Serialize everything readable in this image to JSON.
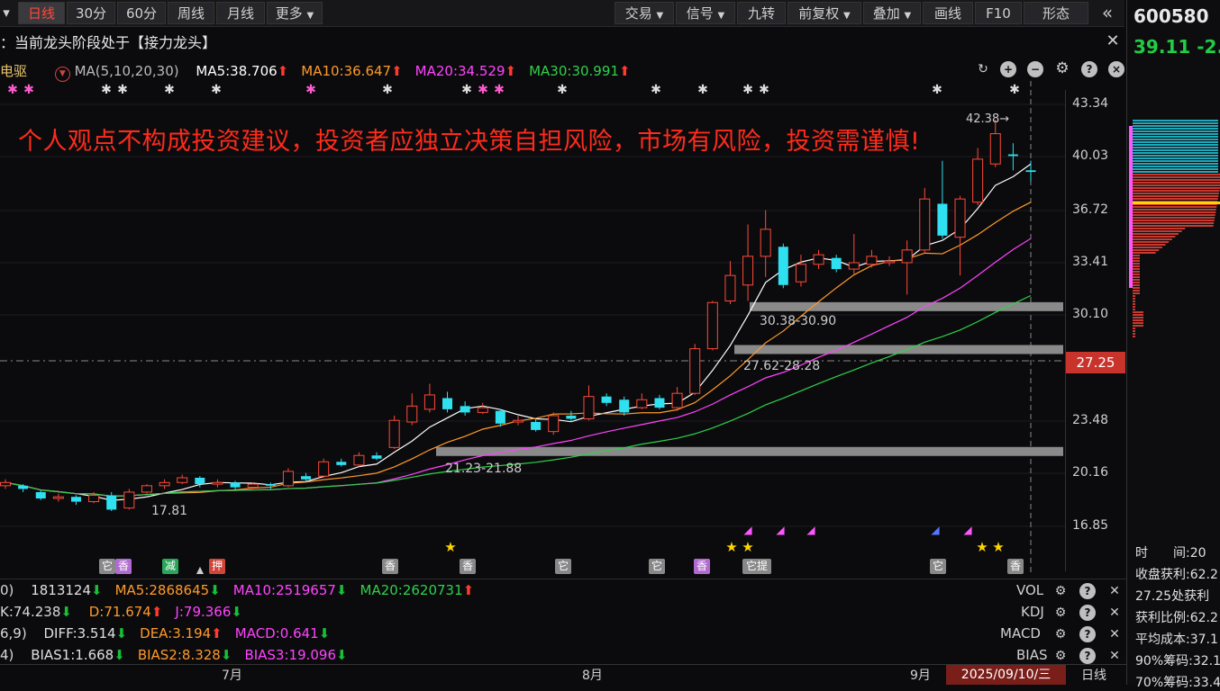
{
  "toolbar": {
    "tabs": [
      {
        "label": "日线",
        "active": true
      },
      {
        "label": "30分",
        "active": false
      },
      {
        "label": "60分",
        "active": false
      },
      {
        "label": "周线",
        "active": false
      },
      {
        "label": "月线",
        "active": false
      },
      {
        "label": "更多",
        "active": false
      }
    ],
    "right_buttons": [
      "交易",
      "信号",
      "九转",
      "前复权",
      "叠加",
      "画线",
      "F10",
      "形态"
    ]
  },
  "subtitle": "：当前龙头阶段处于【接力龙头】",
  "main_indicator": {
    "name": "电驱",
    "params": "MA(5,10,20,30)",
    "items": [
      {
        "label": "MA5:38.706",
        "color": "#ffffff",
        "dir": "up"
      },
      {
        "label": "MA10:36.647",
        "color": "#ff9a2a",
        "dir": "up"
      },
      {
        "label": "MA20:34.529",
        "color": "#ff44ff",
        "dir": "up"
      },
      {
        "label": "MA30:30.991",
        "color": "#2fd14a",
        "dir": "up"
      }
    ]
  },
  "warning": "个人观点不构成投资建议，投资者应独立决策自担风险，市场有风险，投资需谨慎!",
  "price_ticks": [
    "43.34",
    "40.03",
    "36.72",
    "33.41",
    "30.10",
    "23.48",
    "20.16",
    "16.85"
  ],
  "current_price_label": "27.25",
  "zones": [
    {
      "label": "30.38-30.90"
    },
    {
      "label": "27.62-28.28"
    },
    {
      "label": "21.23-21.88"
    }
  ],
  "annotations": {
    "low": "17.81",
    "high": "42.38→"
  },
  "tags": [
    {
      "label": "它",
      "color": "#888"
    },
    {
      "label": "香",
      "color": "#b06ad0"
    },
    {
      "label": "减",
      "color": "#2aa55a"
    },
    {
      "label": "押",
      "color": "#d0453a"
    },
    {
      "label": "香",
      "color": "#888"
    },
    {
      "label": "香",
      "color": "#888"
    },
    {
      "label": "它",
      "color": "#888"
    },
    {
      "label": "它",
      "color": "#888"
    },
    {
      "label": "香",
      "color": "#b06ad0"
    },
    {
      "label": "它提",
      "color": "#888"
    },
    {
      "label": "它",
      "color": "#888"
    },
    {
      "label": "香",
      "color": "#888"
    }
  ],
  "indicators": {
    "vol": {
      "lead": "0)",
      "items": [
        {
          "label": "1813124",
          "color": "#e0e0e0",
          "dir": "dn"
        },
        {
          "label": "MA5:2868645",
          "color": "#ff9a2a",
          "dir": "dn"
        },
        {
          "label": "MA10:2519657",
          "color": "#ff44ff",
          "dir": "dn"
        },
        {
          "label": "MA20:2620731",
          "color": "#2fd14a",
          "dir": "up"
        }
      ],
      "name": "VOL"
    },
    "kdj": {
      "lead": "K:74.238",
      "items": [
        {
          "label": "D:71.674",
          "color": "#ff9a2a",
          "dir": "up"
        },
        {
          "label": "J:79.366",
          "color": "#ff44ff",
          "dir": "dn"
        }
      ],
      "name": "KDJ"
    },
    "macd": {
      "lead": "6,9)",
      "items": [
        {
          "label": "DIFF:3.514",
          "color": "#e0e0e0",
          "dir": "dn"
        },
        {
          "label": "DEA:3.194",
          "color": "#ff9a2a",
          "dir": "up"
        },
        {
          "label": "MACD:0.641",
          "color": "#ff44ff",
          "dir": "dn"
        }
      ],
      "name": "MACD"
    },
    "bias": {
      "lead": "4)",
      "items": [
        {
          "label": "BIAS1:1.668",
          "color": "#e0e0e0",
          "dir": "dn"
        },
        {
          "label": "BIAS2:8.328",
          "color": "#ff9a2a",
          "dir": "dn"
        },
        {
          "label": "BIAS3:19.096",
          "color": "#ff44ff",
          "dir": "dn"
        }
      ],
      "name": "BIAS"
    }
  },
  "x_axis": {
    "months": [
      "7月",
      "8月",
      "9月"
    ],
    "date": "2025/09/10/三",
    "period": "日线"
  },
  "right_panel": {
    "code": "600580",
    "price": "39.11",
    "change": "-2.",
    "lines": [
      "时　　间:20",
      "收盘获利:62.2",
      "27.25处获利",
      "获利比例:62.2",
      "平均成本:37.1",
      "90%筹码:32.1",
      "70%筹码:33.4"
    ]
  },
  "chart_data": {
    "type": "candlestick",
    "ylim": [
      15.4,
      44.8
    ],
    "candles": [
      [
        19.4,
        19.6,
        19.8,
        19.2
      ],
      [
        19.4,
        19.2,
        19.5,
        19.0
      ],
      [
        19.0,
        18.6,
        19.1,
        18.5
      ],
      [
        18.6,
        18.7,
        18.9,
        18.4
      ],
      [
        18.7,
        18.4,
        18.8,
        18.2
      ],
      [
        18.4,
        18.8,
        19.0,
        18.3
      ],
      [
        18.8,
        17.9,
        19.0,
        17.81
      ],
      [
        18.0,
        19.0,
        19.2,
        17.9
      ],
      [
        19.0,
        19.4,
        19.5,
        18.9
      ],
      [
        19.4,
        19.6,
        19.8,
        19.2
      ],
      [
        19.6,
        19.9,
        20.1,
        19.5
      ],
      [
        19.9,
        19.5,
        20.0,
        19.3
      ],
      [
        19.5,
        19.6,
        19.8,
        19.3
      ],
      [
        19.6,
        19.3,
        19.7,
        19.1
      ],
      [
        19.3,
        19.5,
        19.6,
        19.2
      ],
      [
        19.5,
        19.4,
        19.6,
        19.2
      ],
      [
        19.4,
        20.3,
        20.5,
        19.3
      ],
      [
        20.0,
        19.8,
        20.2,
        19.6
      ],
      [
        20.0,
        20.9,
        21.1,
        19.9
      ],
      [
        20.9,
        20.7,
        21.1,
        20.6
      ],
      [
        20.7,
        21.3,
        21.5,
        20.6
      ],
      [
        21.3,
        21.1,
        21.5,
        21.0
      ],
      [
        21.8,
        23.5,
        23.8,
        21.7
      ],
      [
        23.4,
        24.4,
        25.2,
        23.2
      ],
      [
        24.2,
        25.1,
        25.8,
        24.0
      ],
      [
        24.9,
        24.2,
        25.3,
        24.0
      ],
      [
        24.4,
        24.0,
        24.7,
        23.8
      ],
      [
        24.0,
        24.3,
        24.6,
        23.9
      ],
      [
        24.1,
        23.3,
        24.2,
        23.1
      ],
      [
        23.4,
        23.5,
        23.8,
        23.2
      ],
      [
        23.4,
        22.9,
        23.6,
        22.8
      ],
      [
        22.8,
        23.8,
        24.0,
        22.6
      ],
      [
        23.8,
        23.6,
        24.1,
        23.4
      ],
      [
        23.6,
        25.0,
        25.7,
        23.5
      ],
      [
        25.0,
        24.6,
        25.2,
        24.4
      ],
      [
        24.8,
        24.0,
        25.0,
        23.8
      ],
      [
        24.3,
        24.8,
        25.2,
        24.2
      ],
      [
        24.9,
        24.3,
        25.1,
        24.2
      ],
      [
        24.3,
        25.2,
        25.6,
        24.1
      ],
      [
        25.2,
        28.0,
        28.3,
        25.1
      ],
      [
        28.0,
        30.9,
        31.0,
        27.9
      ],
      [
        31.0,
        32.6,
        33.5,
        30.8
      ],
      [
        32.0,
        33.8,
        35.8,
        31.0
      ],
      [
        33.8,
        35.5,
        36.7,
        32.5
      ],
      [
        34.4,
        32.0,
        34.6,
        31.8
      ],
      [
        32.2,
        33.3,
        33.9,
        31.9
      ],
      [
        33.3,
        33.9,
        34.2,
        33.0
      ],
      [
        33.7,
        33.0,
        33.9,
        32.8
      ],
      [
        33.0,
        33.4,
        35.2,
        32.7
      ],
      [
        33.3,
        33.8,
        34.2,
        33.1
      ],
      [
        33.4,
        33.5,
        33.8,
        33.2
      ],
      [
        33.4,
        34.2,
        34.8,
        31.4
      ],
      [
        34.2,
        37.4,
        38.1,
        34.0
      ],
      [
        37.1,
        35.1,
        39.8,
        34.9
      ],
      [
        35.0,
        37.4,
        37.6,
        32.6
      ],
      [
        37.2,
        39.9,
        40.6,
        37.0
      ],
      [
        39.6,
        41.5,
        42.38,
        39.4
      ],
      [
        40.2,
        40.1,
        40.9,
        39.2
      ],
      [
        39.2,
        39.1,
        39.8,
        38.5
      ]
    ]
  }
}
